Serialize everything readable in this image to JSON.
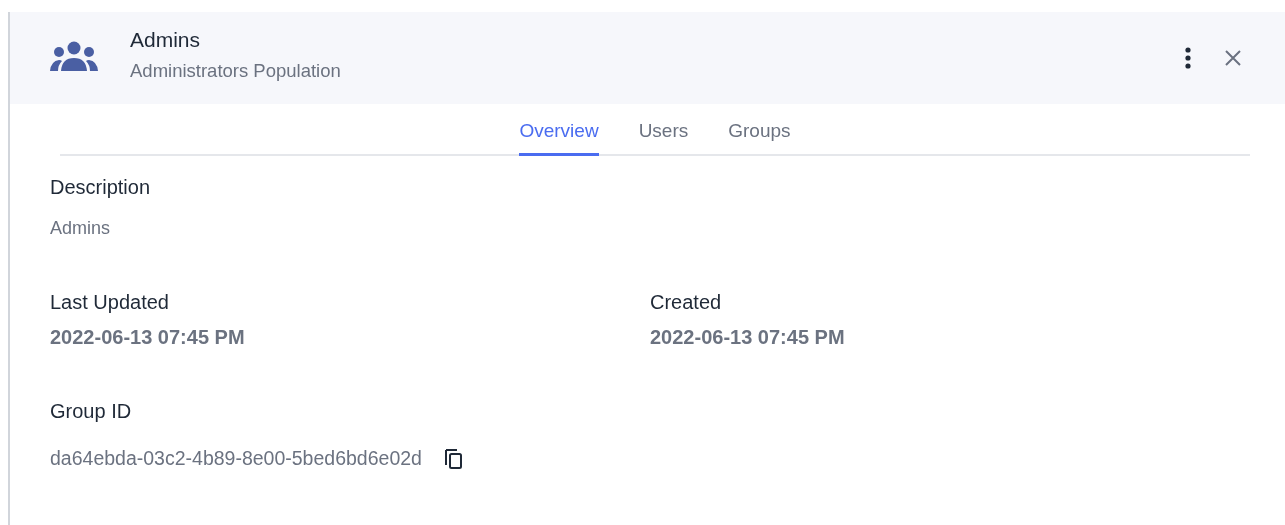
{
  "header": {
    "title": "Admins",
    "subtitle": "Administrators Population"
  },
  "tabs": [
    {
      "label": "Overview",
      "selected": true
    },
    {
      "label": "Users",
      "selected": false
    },
    {
      "label": "Groups",
      "selected": false
    }
  ],
  "description": {
    "label": "Description",
    "value": "Admins"
  },
  "dates": [
    {
      "label": "Last Updated",
      "value": "2022-06-13 07:45 PM"
    },
    {
      "label": "Created",
      "value": "2022-06-13 07:45 PM"
    }
  ],
  "group_id": {
    "label": "Group ID",
    "value": "da64ebda-03c2-4b89-8e00-5bed6bd6e02d"
  }
}
